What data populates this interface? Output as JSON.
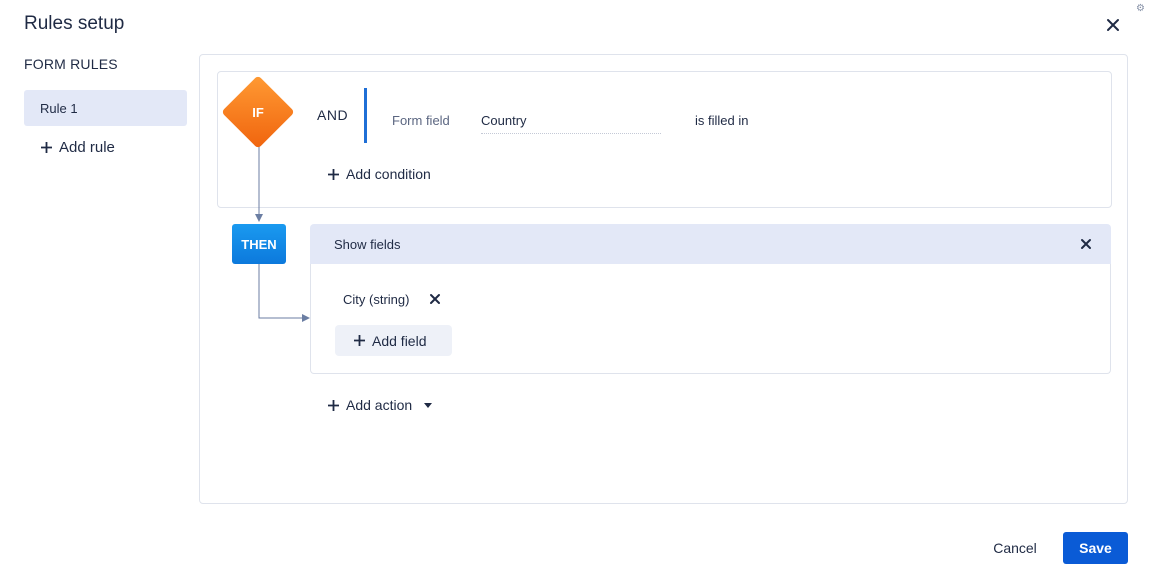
{
  "dialog": {
    "title": "Rules setup",
    "settings_icon": "gear-icon",
    "close_icon": "close-icon"
  },
  "sidebar": {
    "heading": "FORM RULES",
    "rules": [
      {
        "label": "Rule 1",
        "selected": true
      }
    ],
    "add_rule_label": "Add rule"
  },
  "condition": {
    "if_label": "IF",
    "operator": "AND",
    "field_type_label": "Form field",
    "field_value": "Country",
    "comparison": "is filled in",
    "add_condition_label": "Add condition"
  },
  "action": {
    "then_label": "THEN",
    "title": "Show fields",
    "fields": [
      {
        "label": "City (string)"
      }
    ],
    "add_field_label": "Add field",
    "add_action_label": "Add action"
  },
  "footer": {
    "cancel_label": "Cancel",
    "save_label": "Save"
  },
  "colors": {
    "accent": "#0a5bd6",
    "if_orange": "#f0640e",
    "then_blue": "#1a9af0",
    "selected_bg": "#e3e8f7"
  }
}
